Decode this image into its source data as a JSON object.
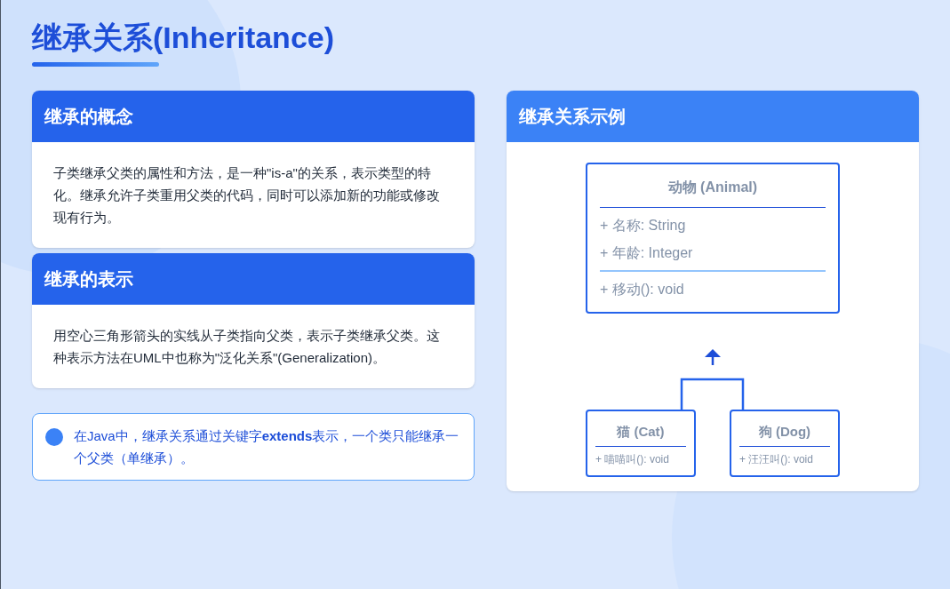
{
  "title": "继承关系(Inheritance)",
  "concept_cards": [
    {
      "heading": "继承的概念",
      "body": "子类继承父类的属性和方法，是一种\"is-a\"的关系，表示类型的特化。继承允许子类重用父类的代码，同时可以添加新的功能或修改现有行为。"
    },
    {
      "heading": "继承的表示",
      "body": "用空心三角形箭头的实线从子类指向父类，表示子类继承父类。这种表示方法在UML中也称为\"泛化关系\"(Generalization)。"
    }
  ],
  "note": {
    "text": "在Java中，继承关系通过关键字**extends**表示，一个类只能继承一个父类（单继承）。"
  },
  "example": {
    "heading": "继承关系示例",
    "parent": {
      "name": "动物 (Animal)",
      "attributes": [
        "+ 名称: String",
        "+ 年龄: Integer"
      ],
      "methods": [
        "+ 移动(): void"
      ]
    },
    "children": [
      {
        "name": "猫 (Cat)",
        "methods": [
          "+ 喵喵叫(): void"
        ]
      },
      {
        "name": "狗 (Dog)",
        "methods": [
          "+ 汪汪叫(): void"
        ]
      }
    ]
  }
}
